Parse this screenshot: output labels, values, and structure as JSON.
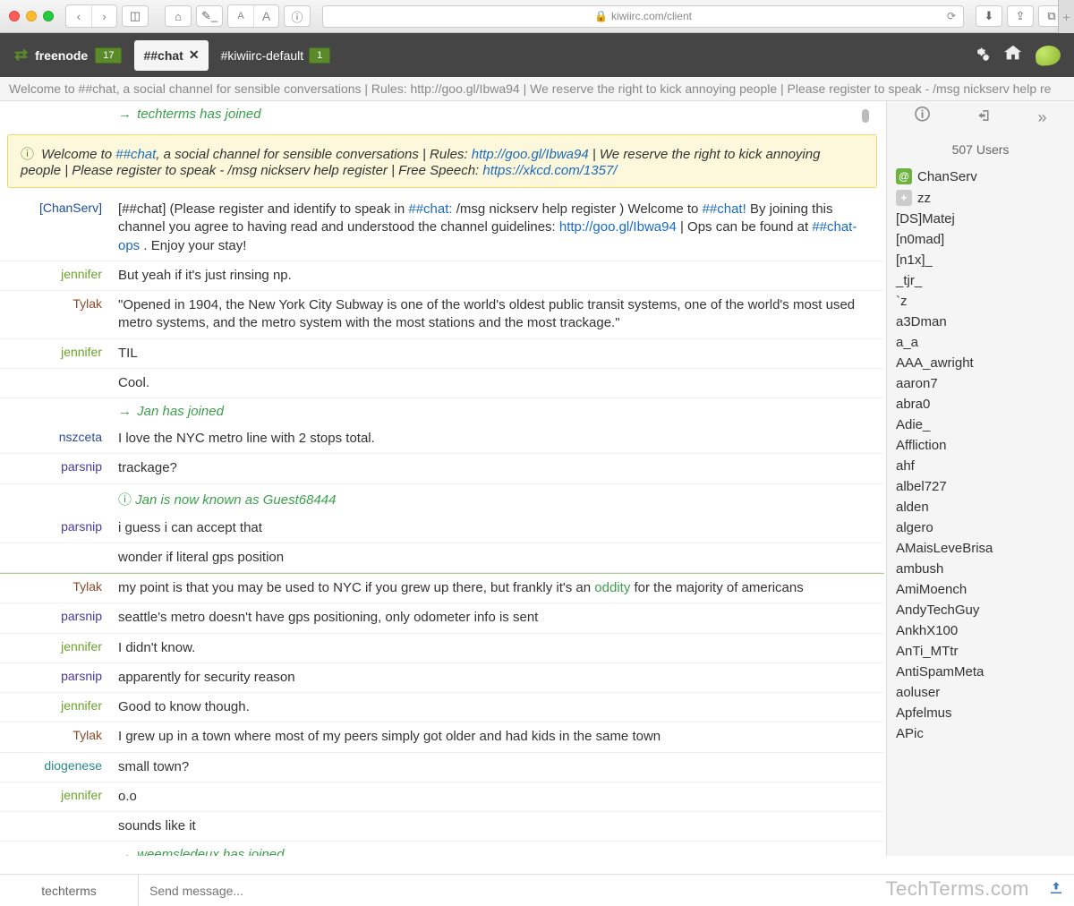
{
  "browser": {
    "url": "kiwiirc.com/client"
  },
  "tabs": {
    "network": "freenode",
    "network_badge": "17",
    "active": "##chat",
    "other": "#kiwiirc-default",
    "other_badge": "1"
  },
  "topic": "Welcome to ##chat, a social channel for sensible conversations | Rules: http://goo.gl/Ibwa94 | We reserve the right to kick annoying people | Please register to speak - /msg nickserv help re",
  "notice": {
    "pre": "Welcome to ",
    "chan": "##chat",
    "mid1": ", a social channel for sensible conversations | Rules: ",
    "link1": "http://goo.gl/Ibwa94",
    "mid2": " | We reserve the right to kick annoying people | Please register to speak - /msg nickserv help register | Free Speech: ",
    "link2": "https://xkcd.com/1357/"
  },
  "joins": {
    "j0": "techterms has joined",
    "j1": "Jan has joined",
    "j2": "Jan is now known as Guest68444",
    "j3": "weemsledeux has joined"
  },
  "nickcolors": {
    "ChanServ": "#1a4b9b",
    "jennifer": "#6aa32a",
    "Tylak": "#8a4a2a",
    "nszceta": "#2a4a9a",
    "parsnip": "#4a3a9a",
    "diogenese": "#2a8a8a"
  },
  "messages": [
    {
      "nick": "[ChanServ]",
      "color": "#1a4b9b",
      "body": "[##chat] (Please register and identify to speak in ",
      "seg": [
        {
          "t": "##chat:",
          "c": "link"
        },
        {
          "t": " /msg nickserv help register ) Welcome to "
        },
        {
          "t": "##chat!",
          "c": "link"
        },
        {
          "t": " By joining this channel you agree to having read and understood the channel guidelines: "
        },
        {
          "t": "http://goo.gl/Ibwa94",
          "c": "link"
        },
        {
          "t": " | Ops can be found at "
        },
        {
          "t": "##chat-ops",
          "c": "link"
        },
        {
          "t": " . Enjoy your stay!"
        }
      ]
    },
    {
      "nick": "jennifer",
      "color": "#6aa32a",
      "text": "But yeah if it's just rinsing np."
    },
    {
      "nick": "Tylak",
      "color": "#8a4a2a",
      "text": "\"Opened in 1904, the New York City Subway is one of the world's oldest public transit systems, one of the world's most used metro systems, and the metro system with the most stations and the most trackage.\""
    },
    {
      "nick": "jennifer",
      "color": "#6aa32a",
      "text": "TIL"
    },
    {
      "nick": "",
      "color": "",
      "text": "Cool."
    },
    {
      "type": "join",
      "key": "j1"
    },
    {
      "nick": "nszceta",
      "color": "#2a4a9a",
      "text": "I love the NYC metro line with 2 stops total."
    },
    {
      "nick": "parsnip",
      "color": "#4a3a9a",
      "text": "trackage?"
    },
    {
      "type": "nickchange",
      "key": "j2"
    },
    {
      "nick": "parsnip",
      "color": "#4a3a9a",
      "text": "i guess i can accept that"
    },
    {
      "nick": "",
      "color": "",
      "text": "wonder if literal gps position"
    },
    {
      "type": "marker"
    },
    {
      "nick": "Tylak",
      "color": "#8a4a2a",
      "seg": [
        {
          "t": "my point is that you may be used to NYC if you grew up there, but frankly it's an "
        },
        {
          "t": "oddity",
          "c": "green"
        },
        {
          "t": " for the majority of americans"
        }
      ]
    },
    {
      "nick": "parsnip",
      "color": "#4a3a9a",
      "text": "seattle's metro doesn't have gps positioning, only odometer info is sent"
    },
    {
      "nick": "jennifer",
      "color": "#6aa32a",
      "text": "I didn't know."
    },
    {
      "nick": "parsnip",
      "color": "#4a3a9a",
      "text": "apparently for security reason"
    },
    {
      "nick": "jennifer",
      "color": "#6aa32a",
      "text": "Good to know though."
    },
    {
      "nick": "Tylak",
      "color": "#8a4a2a",
      "text": "I grew up in a town where most of my peers simply got older and had kids in the same town"
    },
    {
      "nick": "diogenese",
      "color": "#2a8a8a",
      "text": "small town?"
    },
    {
      "nick": "jennifer",
      "color": "#6aa32a",
      "text": "o.o"
    },
    {
      "nick": "",
      "color": "",
      "text": "sounds like it"
    },
    {
      "type": "join",
      "key": "j3"
    }
  ],
  "user_count": "507 Users",
  "users": [
    {
      "n": "ChanServ",
      "b": "at"
    },
    {
      "n": "zz",
      "b": "plus"
    },
    {
      "n": "[DS]Matej"
    },
    {
      "n": "[n0mad]"
    },
    {
      "n": "[n1x]_"
    },
    {
      "n": "_tjr_"
    },
    {
      "n": "`z"
    },
    {
      "n": "a3Dman"
    },
    {
      "n": "a_a"
    },
    {
      "n": "AAA_awright"
    },
    {
      "n": "aaron7"
    },
    {
      "n": "abra0"
    },
    {
      "n": "Adie_"
    },
    {
      "n": "Affliction"
    },
    {
      "n": "ahf"
    },
    {
      "n": "albel727"
    },
    {
      "n": "alden"
    },
    {
      "n": "algero"
    },
    {
      "n": "AMaisLeveBrisa"
    },
    {
      "n": "ambush"
    },
    {
      "n": "AmiMoench"
    },
    {
      "n": "AndyTechGuy"
    },
    {
      "n": "AnkhX100"
    },
    {
      "n": "AnTi_MTtr"
    },
    {
      "n": "AntiSpamMeta"
    },
    {
      "n": "aoluser"
    },
    {
      "n": "Apfelmus"
    },
    {
      "n": "APic"
    }
  ],
  "input": {
    "nick": "techterms",
    "placeholder": "Send message..."
  },
  "watermark": "TechTerms.com"
}
